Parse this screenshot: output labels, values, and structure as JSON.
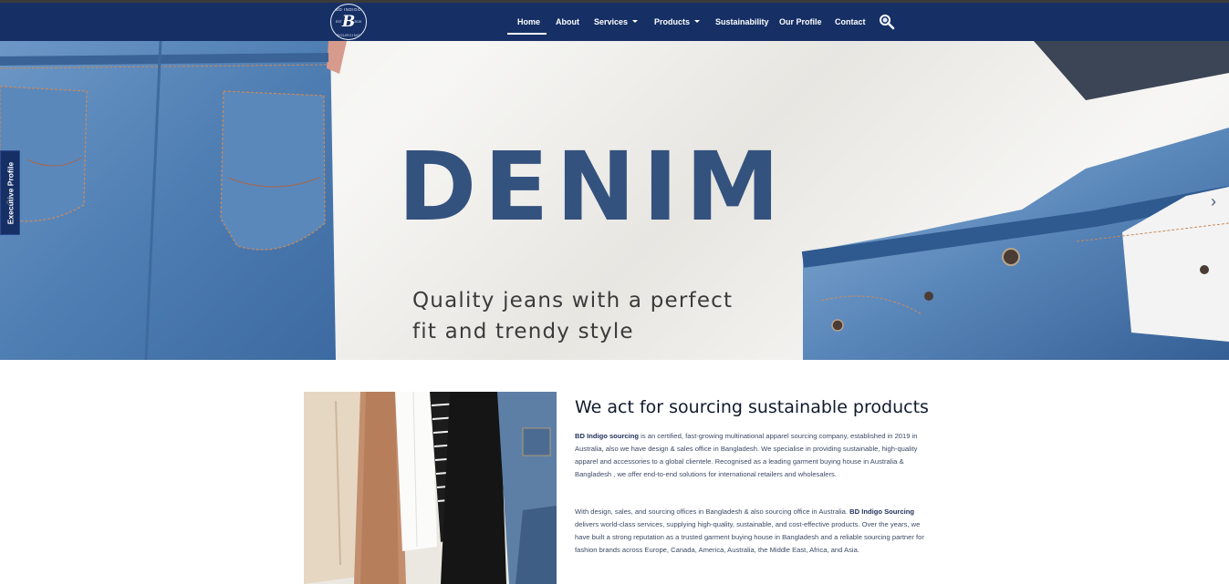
{
  "nav": {
    "logo": {
      "top": "BD INDIGO",
      "mono": "B",
      "bottom": "SOURCING",
      "est": "EST",
      "year": "2019"
    },
    "items": [
      {
        "label": "Home"
      },
      {
        "label": "About"
      },
      {
        "label": "Services"
      },
      {
        "label": "Products"
      },
      {
        "label": "Sustainability"
      },
      {
        "label": "Our Profile"
      },
      {
        "label": "Contact"
      }
    ],
    "search_icon": "search-icon"
  },
  "hero": {
    "title": "DENIM",
    "subtitle_line1": "Quality jeans with a perfect",
    "subtitle_line2": "fit and trendy style",
    "side_tab": "Executive Profile",
    "prev_arrow": "‹",
    "next_arrow": "›"
  },
  "about": {
    "title": "We act for sourcing sustainable products",
    "p1_brand": "BD Indigo sourcing",
    "p1_text": " is an certified, fast-growing multinational apparel  sourcing company, established in 2019 in Australia, also we have design & sales office in Bangladesh. We specialise in providing sustainable, high-quality apparel and accessories to a global clientele. Recognised as a leading garment buying house in Australia & Bangladesh , we offer end-to-end solutions for international retailers and wholesalers.",
    "p2_text_a": "With design, sales, and sourcing   offices in Bangladesh & also sourcing office in Australia. ",
    "p2_brand": "BD Indigo Sourcing",
    "p2_text_b": " delivers world-class services, supplying high-quality, sustainable, and cost-effective products. Over the years, we have built a strong reputation as a trusted garment buying house in Bangladesh and a reliable sourcing partner for fashion brands across Europe, Canada, America, Australia, the Middle East, Africa, and Asia."
  },
  "colors": {
    "nav_bg": "#163066",
    "hero_title": "#34527e",
    "denim": "#5b86b9"
  }
}
